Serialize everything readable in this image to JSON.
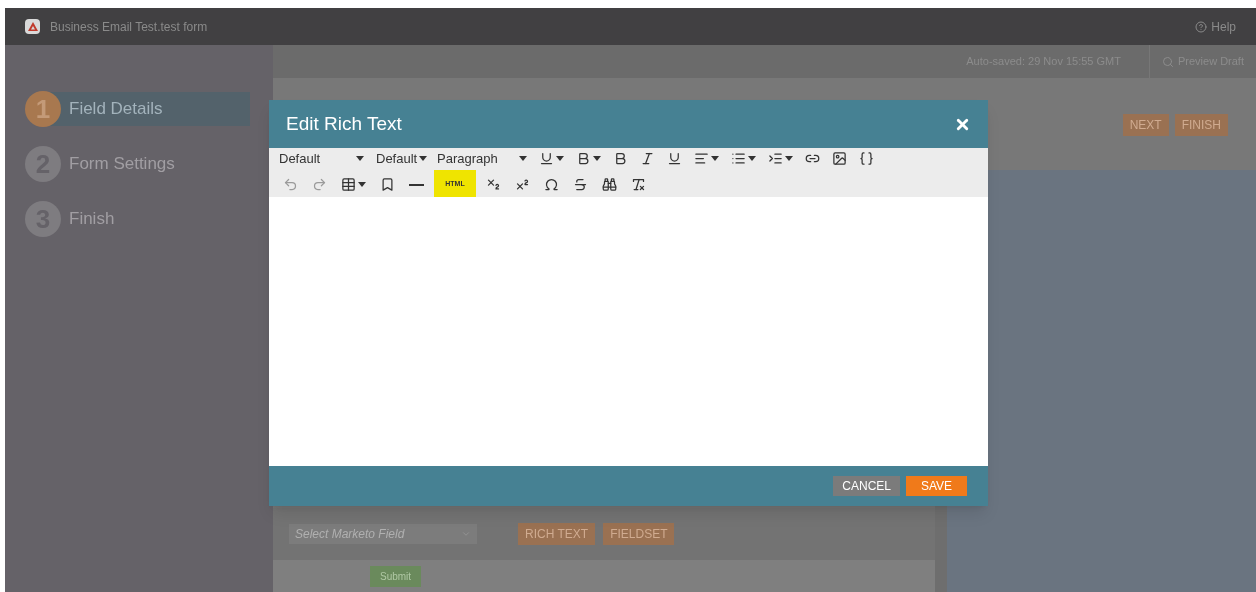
{
  "app_bar": {
    "title": "Business Email Test.test form",
    "help": "Help"
  },
  "steps": [
    {
      "number": "1",
      "label": "Field Details",
      "selected": true
    },
    {
      "number": "2",
      "label": "Form Settings",
      "selected": false
    },
    {
      "number": "3",
      "label": "Finish",
      "selected": false
    }
  ],
  "sub_bar": {
    "autosave": "Auto-saved: 29 Nov 15:55 GMT",
    "preview": "Preview Draft"
  },
  "header_buttons": [
    "NEXT",
    "FINISH"
  ],
  "form": {
    "field_select": {
      "placeholder": "Select Marketo Field"
    },
    "add_buttons": [
      "RICH TEXT",
      "FIELDSET"
    ],
    "submit": "Submit"
  },
  "dialog": {
    "title": "Edit Rich Text",
    "toolbar": {
      "font": "Default",
      "size": "Default",
      "format": "Paragraph",
      "html_button": {
        "label": "HTML",
        "highlighted": true
      }
    },
    "buttons": [
      {
        "label": "CANCEL",
        "kind": "secondary"
      },
      {
        "label": "SAVE",
        "kind": "primary"
      }
    ]
  }
}
